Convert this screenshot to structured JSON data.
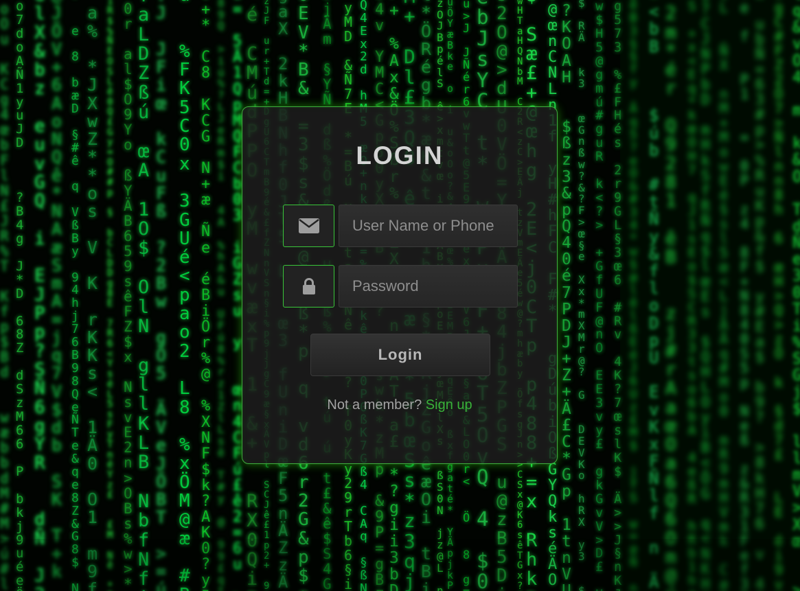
{
  "login_form": {
    "title": "LOGIN",
    "username": {
      "placeholder": "User Name or Phone",
      "value": "",
      "icon": "envelope-icon"
    },
    "password": {
      "placeholder": "Password",
      "value": "",
      "icon": "lock-icon"
    },
    "submit_label": "Login",
    "signup_prompt": "Not a member?",
    "signup_link": "Sign up"
  },
  "colors": {
    "accent": "#39c739",
    "link": "#39b239",
    "card_bg": "#1e1e1e",
    "background": "#010401",
    "rain_green": "#1fdc3f"
  }
}
